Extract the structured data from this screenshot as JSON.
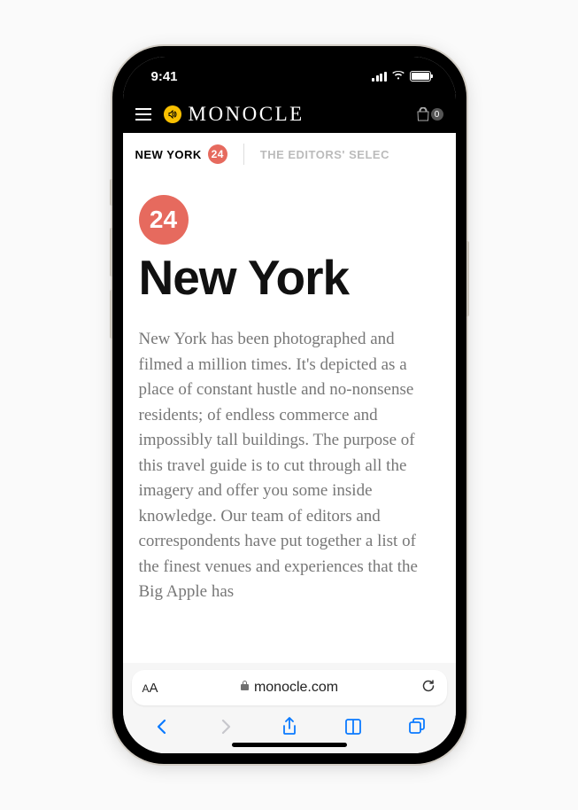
{
  "status": {
    "time": "9:41"
  },
  "header": {
    "brand": "MONOCLE",
    "bag_count": "0"
  },
  "subnav": {
    "primary_label": "NEW YORK",
    "primary_badge": "24",
    "secondary_label": "THE EDITORS' SELEC"
  },
  "article": {
    "badge": "24",
    "title": "New York",
    "body": "New York has been photographed and filmed a million times. It's depicted as a place of constant hustle and no-nonsense residents; of endless commerce and impossibly tall buildings. The purpose of this travel guide is to cut through all the imagery and offer you some inside knowledge. Our team of editors and correspondents have put together a list of the finest venues and experiences that the Big Apple has"
  },
  "browser": {
    "text_size_label": "AA",
    "domain": "monocle.com"
  },
  "colors": {
    "accent_red": "#e66a5e",
    "accent_yellow": "#f9c000",
    "ios_blue": "#0a7aff"
  }
}
